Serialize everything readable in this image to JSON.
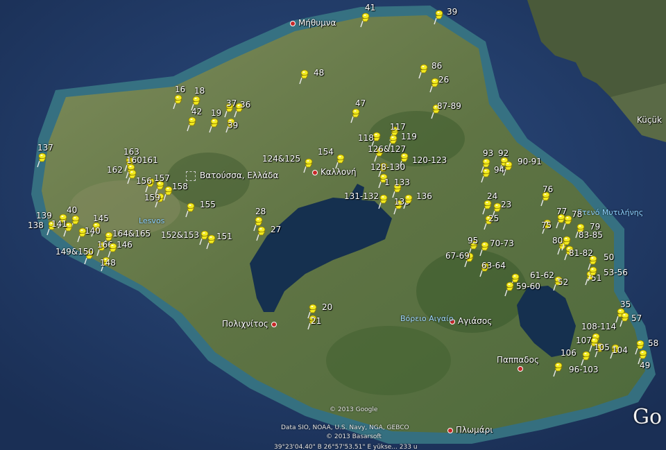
{
  "map": {
    "places": [
      {
        "name": "Μήθυμνα",
        "dot": true
      },
      {
        "name": "Καλλονή",
        "dot": true
      },
      {
        "name": "Βατούσσα, Ελλάδα",
        "dot": false
      },
      {
        "name": "Πολιχνίτος",
        "dot": true
      },
      {
        "name": "Αγιάσος",
        "dot": true
      },
      {
        "name": "Παππαδος",
        "dot": true
      },
      {
        "name": "Πλωμάρι",
        "dot": true
      },
      {
        "name": "Küçük",
        "dot": false
      }
    ],
    "sea_labels": [
      "Στενό Μυτιλήνης",
      "Βόρειο Αιγαίο",
      "Lesvos"
    ],
    "pins": [
      "41",
      "39",
      "86",
      "26",
      "48",
      "87-89",
      "16",
      "18",
      "42",
      "37",
      "36",
      "19",
      "39",
      "47",
      "117",
      "118",
      "119",
      "126&127",
      "120-123",
      "128-130",
      "1",
      "124&125",
      "154",
      "163",
      "160161",
      "162",
      "156",
      "157",
      "158",
      "159",
      "137",
      "93",
      "92",
      "90-91",
      "94",
      "133",
      "131-132",
      "135",
      "136",
      "139",
      "40",
      "138",
      "141",
      "145",
      "140",
      "164&165",
      "166",
      "146",
      "149&150",
      "148",
      "155",
      "152&153",
      "151",
      "28",
      "27",
      "24",
      "23",
      "25",
      "76",
      "77",
      "78",
      "75",
      "79",
      "80",
      "83-85",
      "81-82",
      "95",
      "70-73",
      "67-69",
      "63-64",
      "61-62",
      "52",
      "50",
      "51",
      "53-56",
      "59-60",
      "35",
      "57",
      "20",
      "21",
      "108-114",
      "107",
      "105",
      "104",
      "58",
      "106",
      "96-103",
      "49"
    ],
    "credits": {
      "copyright_google": "© 2013 Google",
      "data_sources": "Data SIO, NOAA, U.S. Navy, NGA, GEBCO",
      "copyright_basarsoft": "© 2013 Basarsoft",
      "coords": "39°23'04.40\" B  26°57'53.51\" E  yükse...  233 u",
      "logo": "Go"
    },
    "colors": {
      "sea": "#24406e",
      "coast": "#3a7a86",
      "land": "#6b7d4e",
      "pin": "#f2ea1e",
      "lake": "#15304f"
    }
  }
}
